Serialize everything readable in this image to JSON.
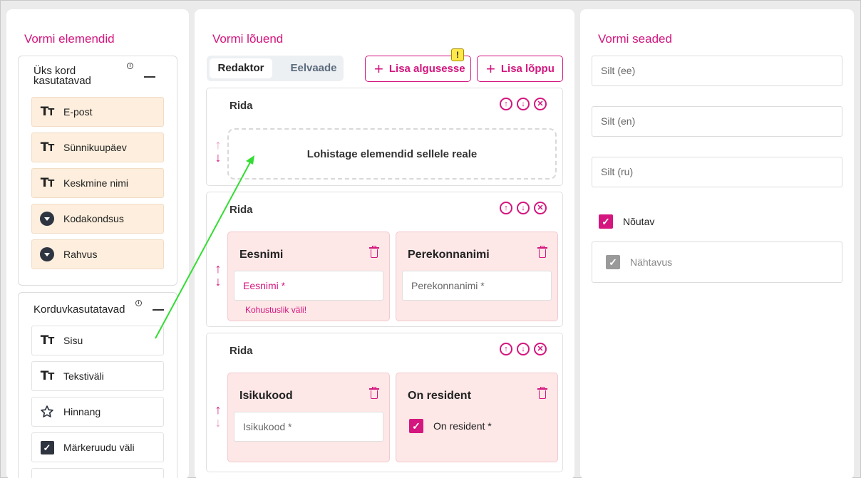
{
  "left_panel": {
    "title": "Vormi elemendid",
    "once_group": {
      "title_line1": "Üks kord",
      "title_line2": "kasutatavad",
      "items": [
        {
          "label": "E-post",
          "icon": "text-type-icon"
        },
        {
          "label": "Sünnikuupäev",
          "icon": "text-type-icon"
        },
        {
          "label": "Keskmine nimi",
          "icon": "text-type-icon"
        },
        {
          "label": "Kodakondsus",
          "icon": "dropdown-icon"
        },
        {
          "label": "Rahvus",
          "icon": "dropdown-icon"
        }
      ]
    },
    "reusable_group": {
      "title": "Korduvkasutatavad",
      "items": [
        {
          "label": "Sisu",
          "icon": "text-type-icon"
        },
        {
          "label": "Tekstiväli",
          "icon": "text-type-icon"
        },
        {
          "label": "Hinnang",
          "icon": "star-icon"
        },
        {
          "label": "Märkeruudu väli",
          "icon": "checkbox-icon"
        }
      ]
    }
  },
  "middle_panel": {
    "title": "Vormi lõuend",
    "tabs": {
      "editor": "Redaktor",
      "preview": "Eelvaade"
    },
    "add_start": "Lisa algusesse",
    "add_end": "Lisa lõppu",
    "warning_badge": "!",
    "rows": [
      {
        "title": "Rida",
        "drop_text": "Lohistage elemendid sellele reale"
      },
      {
        "title": "Rida",
        "fields": [
          {
            "title": "Eesnimi",
            "input": "Eesnimi *",
            "error": "Kohustuslik väli!"
          },
          {
            "title": "Perekonnanimi",
            "input": "Perekonnanimi *"
          }
        ]
      },
      {
        "title": "Rida",
        "fields": [
          {
            "title": "Isikukood",
            "input": "Isikukood *"
          },
          {
            "title": "On resident",
            "checkbox_label": "On resident *"
          }
        ]
      }
    ]
  },
  "right_panel": {
    "title": "Vormi seaded",
    "label_ee": "Silt (ee)",
    "label_en": "Silt (en)",
    "label_ru": "Silt (ru)",
    "required": "Nõutav",
    "visibility": "Nähtavus"
  },
  "colors": {
    "accent": "#d4167e",
    "once_bg": "#fdeedd",
    "field_bg": "#fde7e7",
    "drag_arrow": "#33dd33"
  }
}
